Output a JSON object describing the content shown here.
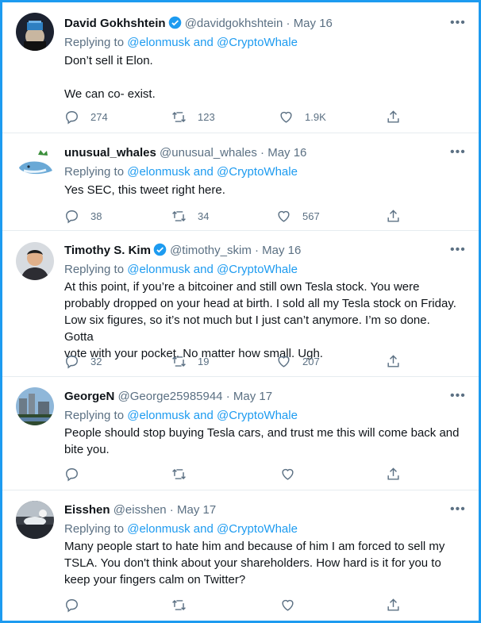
{
  "tweets": [
    {
      "name": "David Gokhshtein",
      "verified": true,
      "handle": "@davidgokhshtein",
      "date": "May 16",
      "replying_prefix": "Replying to ",
      "replying_to": "@elonmusk and @CryptoWhale",
      "lines": [
        "Don’t sell it Elon.",
        "",
        "We can co- exist."
      ],
      "replies": "274",
      "retweets": "123",
      "likes": "1.9K"
    },
    {
      "name": "unusual_whales",
      "verified": false,
      "handle": "@unusual_whales",
      "date": "May 16",
      "replying_prefix": "Replying to ",
      "replying_to": "@elonmusk and @CryptoWhale",
      "lines": [
        "Yes SEC, this tweet right here."
      ],
      "replies": "38",
      "retweets": "34",
      "likes": "567"
    },
    {
      "name": "Timothy S. Kim",
      "verified": true,
      "handle": "@timothy_skim",
      "date": "May 16",
      "replying_prefix": "Replying to ",
      "replying_to": "@elonmusk and @CryptoWhale",
      "lines": [
        "At this point, if you’re a bitcoiner and still own Tesla stock. You were",
        "probably dropped on your head at birth. I sold all my Tesla stock on Friday.",
        "Low six figures, so it’s not much but I just can’t anymore. I’m so done. Gotta",
        "vote with your pocket. No matter how small. Ugh."
      ],
      "replies": "32",
      "retweets": "19",
      "likes": "207"
    },
    {
      "name": "GeorgeN",
      "verified": false,
      "handle": "@George25985944",
      "date": "May 17",
      "replying_prefix": "Replying to ",
      "replying_to": "@elonmusk and @CryptoWhale",
      "lines": [
        "People should stop buying Tesla cars, and trust me this will come back and",
        "bite you."
      ],
      "replies": "",
      "retweets": "",
      "likes": ""
    },
    {
      "name": "Eisshen",
      "verified": false,
      "handle": "@eisshen",
      "date": "May 17",
      "replying_prefix": "Replying to ",
      "replying_to": "@elonmusk and @CryptoWhale",
      "lines": [
        "Many people start to hate him and because of him I am forced to sell my",
        "TSLA. You don't think about your shareholders. How hard is it for you to",
        "keep your fingers calm on Twitter?"
      ],
      "replies": "",
      "retweets": "",
      "likes": ""
    }
  ],
  "separator": " · ",
  "more_glyph": "•••",
  "colors": {
    "accent": "#1d9bf0",
    "muted": "#5b7083",
    "text": "#0f1419"
  }
}
